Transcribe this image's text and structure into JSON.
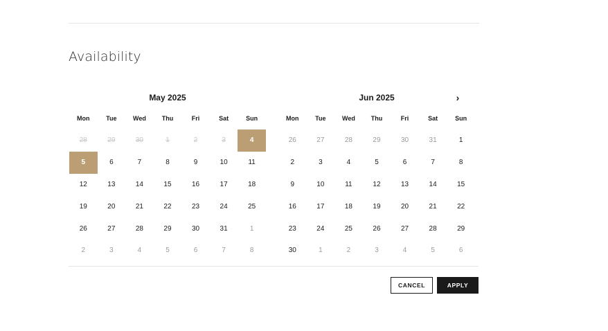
{
  "section": {
    "title": "Availability"
  },
  "calendar": {
    "weekdays": [
      "Mon",
      "Tue",
      "Wed",
      "Thu",
      "Fri",
      "Sat",
      "Sun"
    ],
    "next_icon": "›",
    "months": [
      {
        "title": "May 2025",
        "days": [
          {
            "d": "28",
            "state": "disabled"
          },
          {
            "d": "29",
            "state": "disabled"
          },
          {
            "d": "30",
            "state": "disabled"
          },
          {
            "d": "1",
            "state": "disabled"
          },
          {
            "d": "2",
            "state": "disabled"
          },
          {
            "d": "3",
            "state": "disabled"
          },
          {
            "d": "4",
            "state": "selected"
          },
          {
            "d": "5",
            "state": "selected"
          },
          {
            "d": "6"
          },
          {
            "d": "7"
          },
          {
            "d": "8"
          },
          {
            "d": "9"
          },
          {
            "d": "10"
          },
          {
            "d": "11"
          },
          {
            "d": "12"
          },
          {
            "d": "13"
          },
          {
            "d": "14"
          },
          {
            "d": "15"
          },
          {
            "d": "16"
          },
          {
            "d": "17"
          },
          {
            "d": "18"
          },
          {
            "d": "19"
          },
          {
            "d": "20"
          },
          {
            "d": "21"
          },
          {
            "d": "22"
          },
          {
            "d": "23"
          },
          {
            "d": "24"
          },
          {
            "d": "25"
          },
          {
            "d": "26"
          },
          {
            "d": "27"
          },
          {
            "d": "28"
          },
          {
            "d": "29"
          },
          {
            "d": "30"
          },
          {
            "d": "31"
          },
          {
            "d": "1",
            "state": "outside"
          },
          {
            "d": "2",
            "state": "outside"
          },
          {
            "d": "3",
            "state": "outside"
          },
          {
            "d": "4",
            "state": "outside"
          },
          {
            "d": "5",
            "state": "outside"
          },
          {
            "d": "6",
            "state": "outside"
          },
          {
            "d": "7",
            "state": "outside"
          },
          {
            "d": "8",
            "state": "outside"
          }
        ]
      },
      {
        "title": "Jun 2025",
        "days": [
          {
            "d": "26",
            "state": "outside"
          },
          {
            "d": "27",
            "state": "outside"
          },
          {
            "d": "28",
            "state": "outside"
          },
          {
            "d": "29",
            "state": "outside"
          },
          {
            "d": "30",
            "state": "outside"
          },
          {
            "d": "31",
            "state": "outside"
          },
          {
            "d": "1"
          },
          {
            "d": "2"
          },
          {
            "d": "3"
          },
          {
            "d": "4"
          },
          {
            "d": "5"
          },
          {
            "d": "6"
          },
          {
            "d": "7"
          },
          {
            "d": "8"
          },
          {
            "d": "9"
          },
          {
            "d": "10"
          },
          {
            "d": "11"
          },
          {
            "d": "12"
          },
          {
            "d": "13"
          },
          {
            "d": "14"
          },
          {
            "d": "15"
          },
          {
            "d": "16"
          },
          {
            "d": "17"
          },
          {
            "d": "18"
          },
          {
            "d": "19"
          },
          {
            "d": "20"
          },
          {
            "d": "21"
          },
          {
            "d": "22"
          },
          {
            "d": "23"
          },
          {
            "d": "24"
          },
          {
            "d": "25"
          },
          {
            "d": "26"
          },
          {
            "d": "27"
          },
          {
            "d": "28"
          },
          {
            "d": "29"
          },
          {
            "d": "30"
          },
          {
            "d": "1",
            "state": "outside"
          },
          {
            "d": "2",
            "state": "outside"
          },
          {
            "d": "3",
            "state": "outside"
          },
          {
            "d": "4",
            "state": "outside"
          },
          {
            "d": "5",
            "state": "outside"
          },
          {
            "d": "6",
            "state": "outside"
          }
        ]
      }
    ]
  },
  "actions": {
    "cancel_label": "CANCEL",
    "apply_label": "APPLY"
  },
  "colors": {
    "selected": "#bb9e74",
    "apply_bg": "#1a1a1a"
  }
}
